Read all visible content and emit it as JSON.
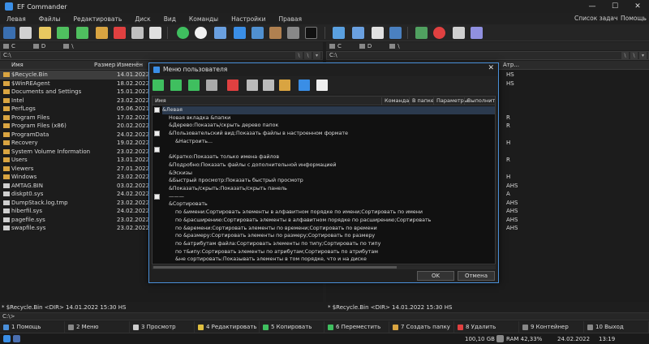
{
  "window": {
    "title": "EF Commander",
    "minimize": "—",
    "maximize": "☐",
    "close": "✕"
  },
  "menu": {
    "left": [
      "Левая",
      "Файлы",
      "Редактировать",
      "Диск",
      "Вид",
      "Команды",
      "Настройки",
      "Правая"
    ],
    "tasklist": "Список задач",
    "help": "Помощь"
  },
  "left_panel": {
    "drives": [
      "C",
      "D",
      "\\"
    ],
    "path": "C:\\",
    "columns": {
      "name": "Имя",
      "size": "Размер",
      "modified": "Изменён"
    },
    "rows": [
      {
        "name": "$Recycle.Bin",
        "size": "<DIR>",
        "date": "14.01.2022",
        "type": "folder"
      },
      {
        "name": "$WinREAgent",
        "size": "<DIR>",
        "date": "18.02.2022",
        "type": "folder"
      },
      {
        "name": "Documents and Settings",
        "size": "<LINK>",
        "date": "15.01.2022",
        "type": "folder"
      },
      {
        "name": "Intel",
        "size": "<DIR>",
        "date": "23.02.2022",
        "type": "folder"
      },
      {
        "name": "PerfLogs",
        "size": "<DIR>",
        "date": "05.06.2021",
        "type": "folder"
      },
      {
        "name": "Program Files",
        "size": "<DIR>",
        "date": "17.02.2022",
        "type": "folder"
      },
      {
        "name": "Program Files (x86)",
        "size": "<DIR>",
        "date": "20.02.2022",
        "type": "folder"
      },
      {
        "name": "ProgramData",
        "size": "<DIR>",
        "date": "24.02.2022",
        "type": "folder"
      },
      {
        "name": "Recovery",
        "size": "<DIR>",
        "date": "19.02.2022",
        "type": "folder"
      },
      {
        "name": "System Volume Information",
        "size": "<DIR>",
        "date": "23.02.2022",
        "type": "folder"
      },
      {
        "name": "Users",
        "size": "<DIR>",
        "date": "13.01.2022",
        "type": "folder"
      },
      {
        "name": "Viewers",
        "size": "<DIR>",
        "date": "27.01.2022",
        "type": "folder"
      },
      {
        "name": "Windows",
        "size": "<DIR>",
        "date": "23.02.2022",
        "type": "folder"
      },
      {
        "name": "AMTAG.BIN",
        "size": "1 024",
        "date": "03.02.2022",
        "type": "file"
      },
      {
        "name": "diskpt0.sys",
        "size": "79 257 600",
        "date": "24.02.2022",
        "type": "file"
      },
      {
        "name": "DumpStack.log.tmp",
        "size": "12 288",
        "date": "23.02.2022",
        "type": "file"
      },
      {
        "name": "hiberfil.sys",
        "size": "3 351 793 ...",
        "date": "24.02.2022",
        "type": "file"
      },
      {
        "name": "pagefile.sys",
        "size": "1 342 177 ...",
        "date": "23.02.2022",
        "type": "file"
      },
      {
        "name": "swapfile.sys",
        "size": "16 777 216",
        "date": "23.02.2022",
        "type": "file"
      }
    ],
    "status": "* $Recycle.Bin   <DIR>  14.01.2022  15:30  HS"
  },
  "right_panel": {
    "drives": [
      "C",
      "D",
      "\\"
    ],
    "path": "C:\\",
    "col_attr": "Атр...",
    "attrs": [
      "HS",
      "HS",
      "",
      "",
      "",
      "R",
      "R",
      "",
      "H",
      "",
      "R",
      "",
      "H",
      "AHS",
      "A",
      "AHS",
      "AHS",
      "AHS",
      "AHS"
    ],
    "status": "* $Recycle.Bin   <DIR>  14.01.2022  15:30  HS"
  },
  "cmdline": "C:\\>",
  "fkeys": [
    {
      "label": "1 Помощь",
      "color": "#4a8fd9"
    },
    {
      "label": "2 Меню",
      "color": "#888888"
    },
    {
      "label": "3 Просмотр",
      "color": "#cccccc"
    },
    {
      "label": "4 Редактировать",
      "color": "#e0c040"
    },
    {
      "label": "5 Копировать",
      "color": "#3fbf5f"
    },
    {
      "label": "6 Переместить",
      "color": "#3fbf5f"
    },
    {
      "label": "7 Создать папку",
      "color": "#d9a441"
    },
    {
      "label": "8 Удалить",
      "color": "#e04040"
    },
    {
      "label": "9 Контейнер",
      "color": "#888888"
    },
    {
      "label": "10 Выход",
      "color": "#888888"
    }
  ],
  "taskbar": {
    "disk": "100,10 GB",
    "ram": "RAM 42,33%",
    "date": "24.02.2022",
    "time": "13:19"
  },
  "dialog": {
    "title": "Меню пользователя",
    "close": "✕",
    "columns": {
      "name": "Имя",
      "command": "Команда",
      "in_folder": "В папке",
      "params": "Параметры",
      "run": "Выполнить"
    },
    "rows": [
      {
        "text": "&Левая",
        "indent": 0,
        "check": true,
        "selected": true
      },
      {
        "text": "Новая вкладка &папки",
        "indent": 1
      },
      {
        "text": "&Дерево:Показать/скрыть дерево папок",
        "indent": 1
      },
      {
        "text": "&Пользовательский вид:Показать файлы в настроенном формате",
        "indent": 1,
        "check": true
      },
      {
        "text": "&Настроить...",
        "indent": 2
      },
      {
        "text": "",
        "indent": 0,
        "check": true
      },
      {
        "text": "&Кратко:Показать только имена файлов",
        "indent": 1
      },
      {
        "text": "&Подробно:Показать файлы с дополнительной информацией",
        "indent": 1
      },
      {
        "text": "&Эскизы",
        "indent": 1
      },
      {
        "text": "&Быстрый просмотр:Показать быстрый просмотр",
        "indent": 1
      },
      {
        "text": "&Показать/скрыть:Показать/скрыть панель",
        "indent": 1
      },
      {
        "text": "———",
        "indent": 1,
        "check": true
      },
      {
        "text": "&Сортировать",
        "indent": 1
      },
      {
        "text": "по &имени:Сортировать элементы в алфавитном порядке по имени;Сортировать по имени",
        "indent": 2
      },
      {
        "text": "по &расширению:Сортировать элементы в алфавитном порядке по расширению;Сортировать",
        "indent": 2
      },
      {
        "text": "по &времени:Сортировать элементы по времени;Сортировать по времени",
        "indent": 2
      },
      {
        "text": "по &размеру:Сортировать элементы по размеру;Сортировать по размеру",
        "indent": 2
      },
      {
        "text": "по &атрибутам файла:Сортировать элементы по типу;Сортировать по типу",
        "indent": 2
      },
      {
        "text": "по т&ипу:Сортировать элементы по атрибутам;Сортировать по атрибутам",
        "indent": 2
      },
      {
        "text": "&не сортировать:Показывать элементы в том порядке, что и на диске",
        "indent": 2
      }
    ],
    "ok": "OK",
    "cancel": "Отмена"
  }
}
